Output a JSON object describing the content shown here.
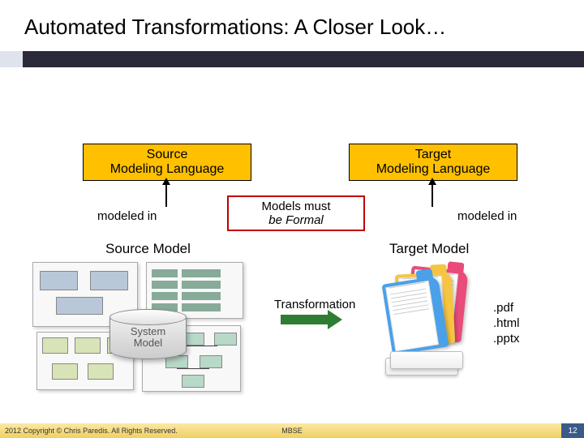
{
  "title": "Automated Transformations: A Closer Look…",
  "source_language": {
    "line1": "Source",
    "line2": "Modeling Language"
  },
  "target_language": {
    "line1": "Target",
    "line2": "Modeling Language"
  },
  "modeled_in_left": "modeled in",
  "modeled_in_right": "modeled in",
  "formal": {
    "line1": "Models must",
    "line2": "be Formal"
  },
  "source_model_label": "Source Model",
  "target_model_label": "Target Model",
  "transformation_label": "Transformation",
  "system_model_label": "System\nModel",
  "output_files": [
    ".pdf",
    ".html",
    ".pptx"
  ],
  "footer": {
    "copyright": "2012 Copyright © Chris Paredis. All Rights Reserved.",
    "center": "MBSE",
    "slide_number": "12"
  }
}
